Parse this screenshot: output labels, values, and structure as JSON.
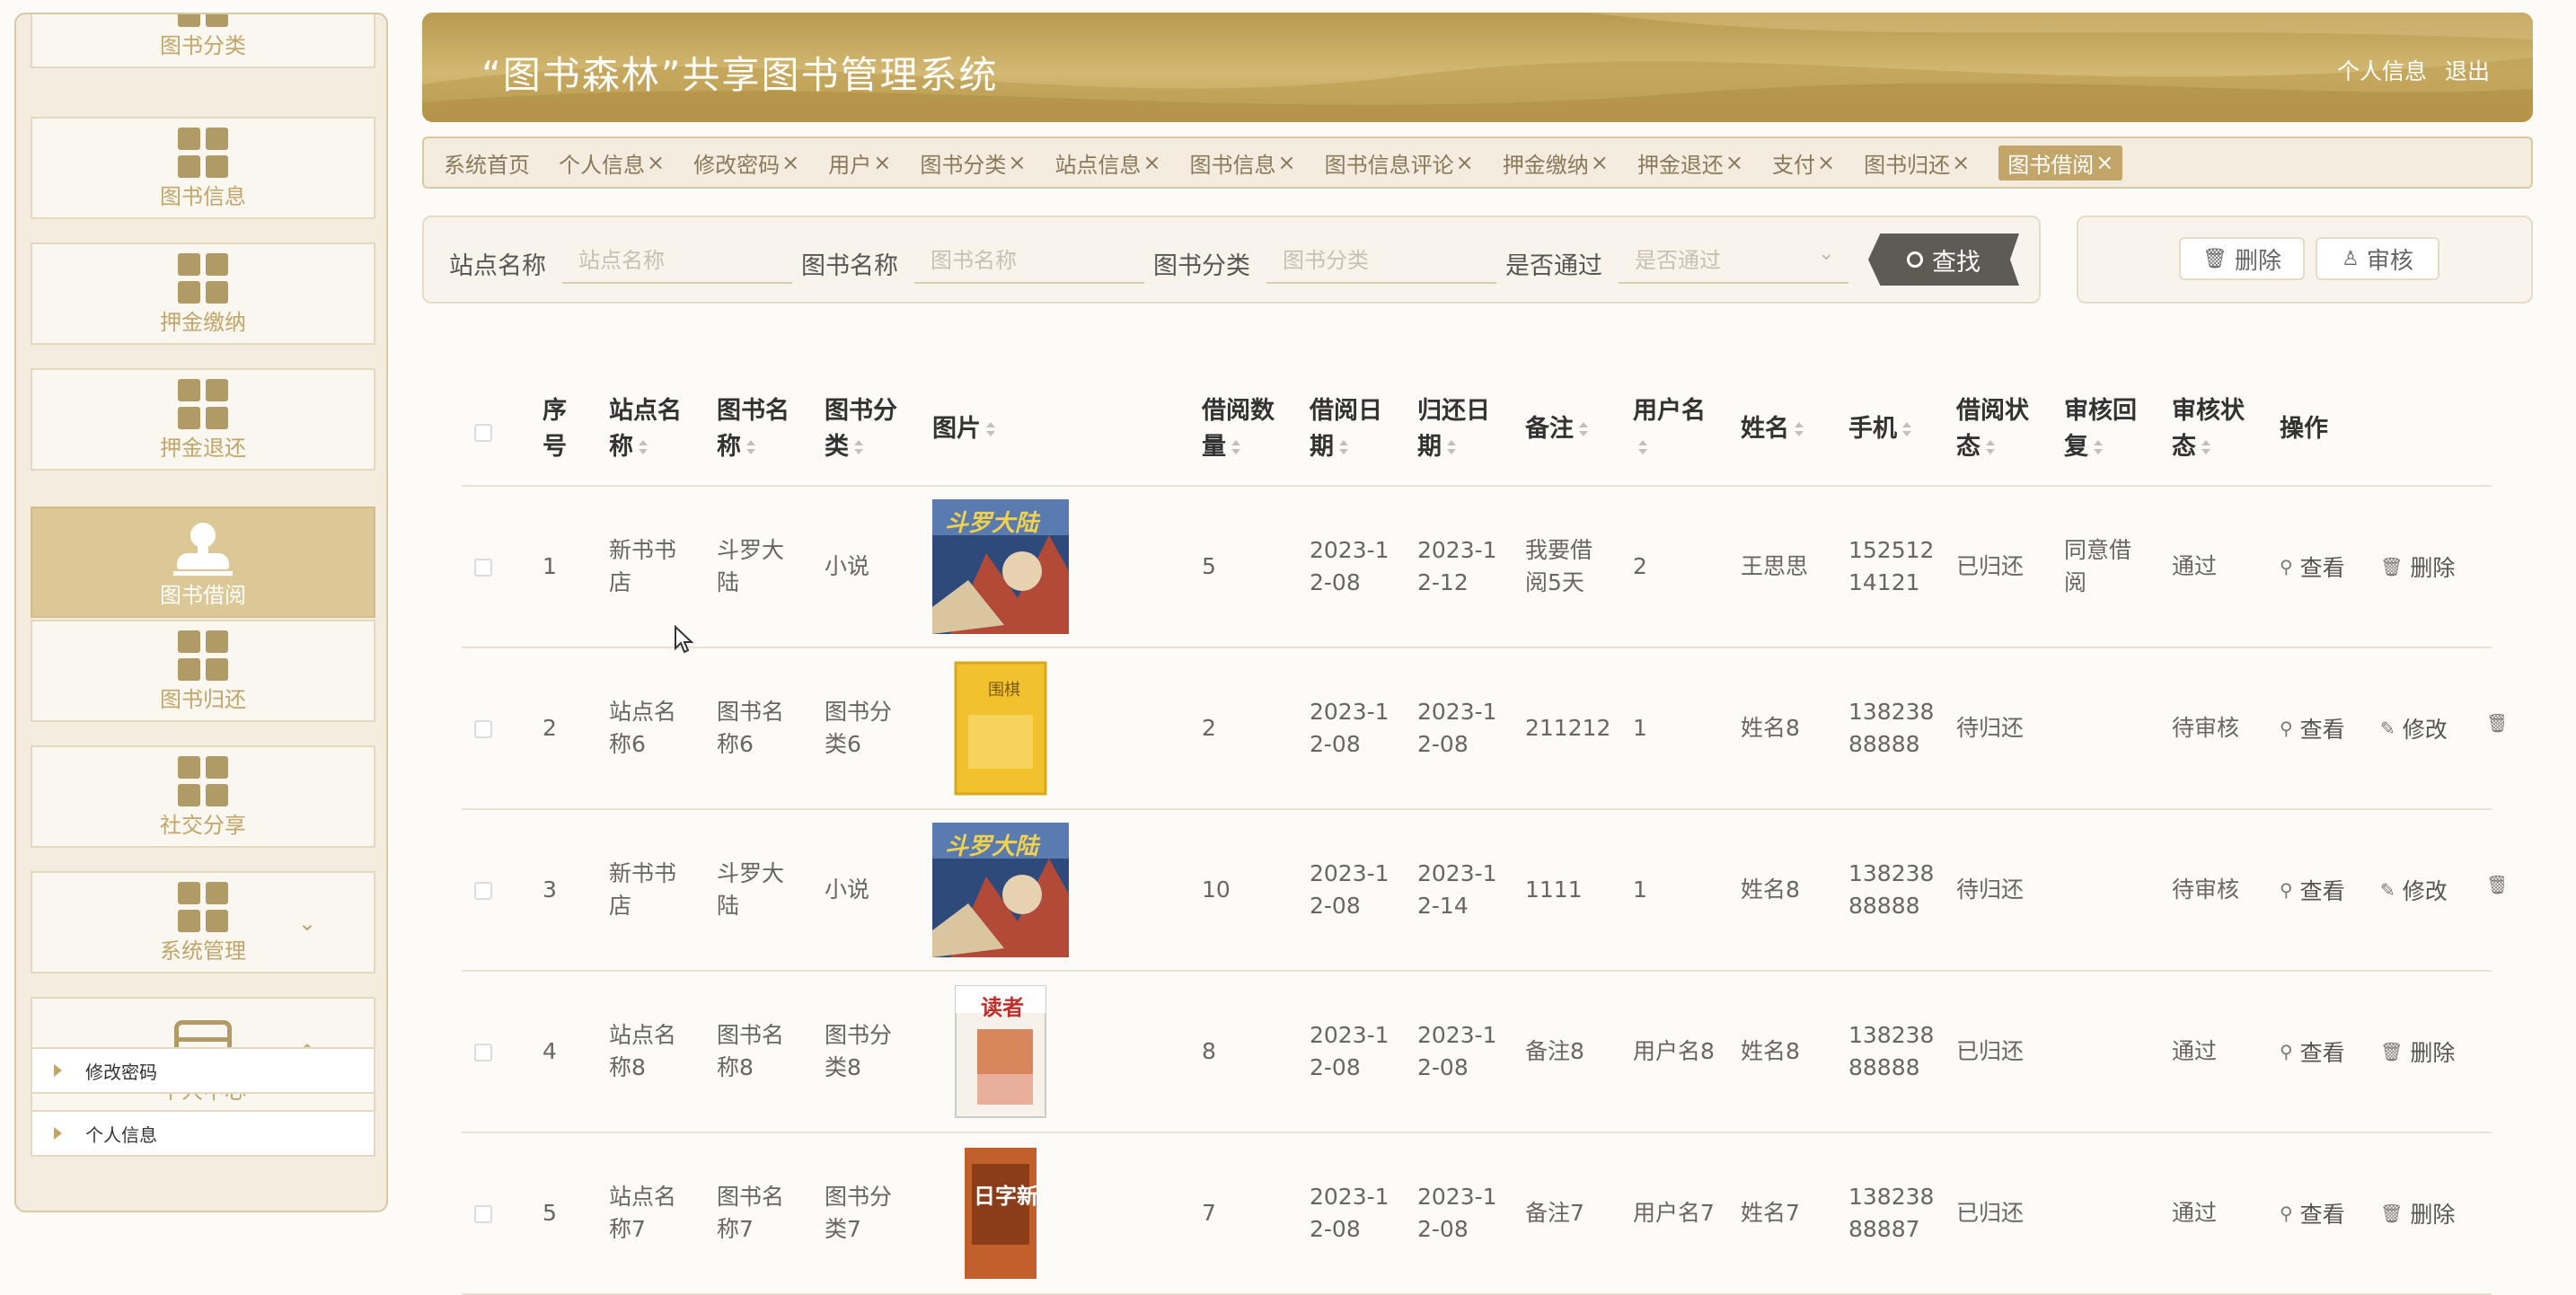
{
  "sidebar": {
    "menu": [
      {
        "label": "图书分类",
        "icon": "grid-icon"
      },
      {
        "label": "图书信息",
        "icon": "grid-icon"
      },
      {
        "label": "押金缴纳",
        "icon": "grid-icon"
      },
      {
        "label": "押金退还",
        "icon": "grid-icon"
      },
      {
        "label": "图书借阅",
        "icon": "user-icon",
        "active": true
      },
      {
        "label": "图书归还",
        "icon": "grid-icon"
      },
      {
        "label": "社交分享",
        "icon": "grid-icon"
      },
      {
        "label": "系统管理",
        "icon": "grid-icon"
      },
      {
        "label": "个人中心",
        "icon": "card-icon"
      }
    ],
    "sub_items": [
      "修改密码",
      "个人信息"
    ]
  },
  "header": {
    "title": "“图书森林”共享图书管理系统",
    "profile_link": "个人信息",
    "logout_link": "退出"
  },
  "tabs": [
    {
      "label": "系统首页",
      "closable": false
    },
    {
      "label": "个人信息",
      "closable": true
    },
    {
      "label": "修改密码",
      "closable": true
    },
    {
      "label": "用户",
      "closable": true
    },
    {
      "label": "图书分类",
      "closable": true
    },
    {
      "label": "站点信息",
      "closable": true
    },
    {
      "label": "图书信息",
      "closable": true
    },
    {
      "label": "图书信息评论",
      "closable": true
    },
    {
      "label": "押金缴纳",
      "closable": true
    },
    {
      "label": "押金退还",
      "closable": true
    },
    {
      "label": "支付",
      "closable": true
    },
    {
      "label": "图书归还",
      "closable": true
    },
    {
      "label": "图书借阅",
      "closable": true,
      "active": true
    }
  ],
  "tab_close": "×",
  "search": {
    "station_label": "站点名称",
    "station_placeholder": "站点名称",
    "book_label": "图书名称",
    "book_placeholder": "图书名称",
    "category_label": "图书分类",
    "category_placeholder": "图书分类",
    "approved_label": "是否通过",
    "approved_placeholder": "是否通过",
    "search_button": "查找"
  },
  "actions": {
    "delete_button": "删除",
    "review_button": "审核"
  },
  "table": {
    "headers": {
      "index": [
        "序",
        "号"
      ],
      "station": [
        "站点名",
        "称"
      ],
      "book": [
        "图书名",
        "称"
      ],
      "category": [
        "图书分",
        "类"
      ],
      "image": "图片",
      "qty": [
        "借阅数",
        "量"
      ],
      "borrow_date": [
        "借阅日",
        "期"
      ],
      "return_date": [
        "归还日",
        "期"
      ],
      "remark": "备注",
      "username": [
        "用户名",
        ""
      ],
      "name": "姓名",
      "phone": "手机",
      "borrow_status": [
        "借阅状",
        "态"
      ],
      "review_reply": [
        "审核回",
        "复"
      ],
      "review_status": [
        "审核状",
        "态"
      ],
      "ops": "操作"
    },
    "op_labels": {
      "view": "查看",
      "edit": "修改",
      "delete": "删除"
    },
    "rows": [
      {
        "index": "1",
        "station": [
          "新书书",
          "店"
        ],
        "book": [
          "斗罗大",
          "陆"
        ],
        "category": [
          "小说",
          ""
        ],
        "qty": "5",
        "borrow_date": [
          "2023-1",
          "2-08"
        ],
        "return_date": [
          "2023-1",
          "2-12"
        ],
        "remark": [
          "我要借",
          "阅5天"
        ],
        "username": "2",
        "name": "王思思",
        "phone": [
          "152512",
          "14121"
        ],
        "borrow_status": "已归还",
        "review_reply": [
          "同意借",
          "阅"
        ],
        "review_status": "通过",
        "cover": "douluo",
        "ops": [
          "view",
          "delete"
        ]
      },
      {
        "index": "2",
        "station": [
          "站点名",
          "称6"
        ],
        "book": [
          "图书名",
          "称6"
        ],
        "category": [
          "图书分",
          "类6"
        ],
        "qty": "2",
        "borrow_date": [
          "2023-1",
          "2-08"
        ],
        "return_date": [
          "2023-1",
          "2-08"
        ],
        "remark": [
          "211212",
          ""
        ],
        "username": "1",
        "name": "姓名8",
        "phone": [
          "138238",
          "88888"
        ],
        "borrow_status": "待归还",
        "review_reply": [
          "",
          ""
        ],
        "review_status": "待审核",
        "cover": "yellow",
        "ops": [
          "view",
          "edit",
          "delete-clipped"
        ]
      },
      {
        "index": "3",
        "station": [
          "新书书",
          "店"
        ],
        "book": [
          "斗罗大",
          "陆"
        ],
        "category": [
          "小说",
          ""
        ],
        "qty": "10",
        "borrow_date": [
          "2023-1",
          "2-08"
        ],
        "return_date": [
          "2023-1",
          "2-14"
        ],
        "remark": [
          "1111",
          ""
        ],
        "username": "1",
        "name": "姓名8",
        "phone": [
          "138238",
          "88888"
        ],
        "borrow_status": "待归还",
        "review_reply": [
          "",
          ""
        ],
        "review_status": "待审核",
        "cover": "douluo",
        "ops": [
          "view",
          "edit",
          "delete-clipped"
        ]
      },
      {
        "index": "4",
        "station": [
          "站点名",
          "称8"
        ],
        "book": [
          "图书名",
          "称8"
        ],
        "category": [
          "图书分",
          "类8"
        ],
        "qty": "8",
        "borrow_date": [
          "2023-1",
          "2-08"
        ],
        "return_date": [
          "2023-1",
          "2-08"
        ],
        "remark": [
          "备注8",
          ""
        ],
        "username": "用户名8",
        "name": "姓名8",
        "phone": [
          "138238",
          "88888"
        ],
        "borrow_status": "已归还",
        "review_reply": [
          "",
          ""
        ],
        "review_status": "通过",
        "cover": "duzhe",
        "ops": [
          "view",
          "delete"
        ]
      },
      {
        "index": "5",
        "station": [
          "站点名",
          "称7"
        ],
        "book": [
          "图书名",
          "称7"
        ],
        "category": [
          "图书分",
          "类7"
        ],
        "qty": "7",
        "borrow_date": [
          "2023-1",
          "2-08"
        ],
        "return_date": [
          "2023-1",
          "2-08"
        ],
        "remark": [
          "备注7",
          ""
        ],
        "username": "用户名7",
        "name": "姓名7",
        "phone": [
          "138238",
          "88887"
        ],
        "borrow_status": "已归还",
        "review_reply": [
          "",
          ""
        ],
        "review_status": "通过",
        "cover": "orange",
        "ops": [
          "view",
          "delete"
        ]
      }
    ]
  },
  "covers": {
    "douluo_title": "斗罗大陆",
    "yellow_title": "围棋",
    "duzhe_title": "读者",
    "orange_title": "日字新"
  },
  "colors": {
    "accent": "#c2a568",
    "header_gold": "#c9ab62",
    "dark_button": "#5e5a54"
  }
}
